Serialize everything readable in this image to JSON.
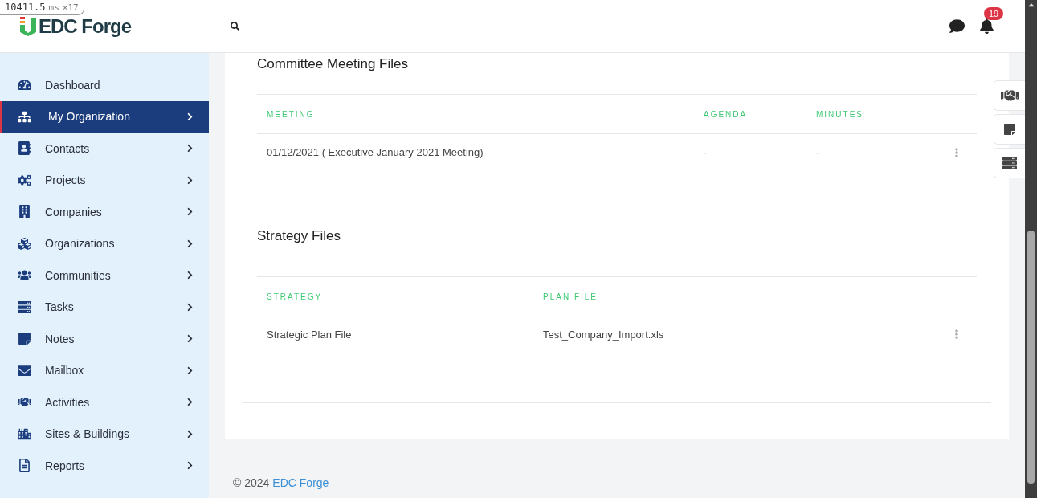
{
  "debug_overlay": {
    "time": "10411.5",
    "unit": "ms",
    "count": "×17"
  },
  "header": {
    "logo": "EDC Forge",
    "notifications": "19"
  },
  "sidebar": {
    "items": [
      {
        "label": "Dashboard",
        "selected": false,
        "expandable": false
      },
      {
        "label": "My Organization",
        "selected": true,
        "expandable": true
      },
      {
        "label": "Contacts",
        "selected": false,
        "expandable": true
      },
      {
        "label": "Projects",
        "selected": false,
        "expandable": true
      },
      {
        "label": "Companies",
        "selected": false,
        "expandable": true
      },
      {
        "label": "Organizations",
        "selected": false,
        "expandable": true
      },
      {
        "label": "Communities",
        "selected": false,
        "expandable": true
      },
      {
        "label": "Tasks",
        "selected": false,
        "expandable": true
      },
      {
        "label": "Notes",
        "selected": false,
        "expandable": true
      },
      {
        "label": "Mailbox",
        "selected": false,
        "expandable": true
      },
      {
        "label": "Activities",
        "selected": false,
        "expandable": true
      },
      {
        "label": "Sites & Buildings",
        "selected": false,
        "expandable": true
      },
      {
        "label": "Reports",
        "selected": false,
        "expandable": true
      }
    ]
  },
  "sections": [
    {
      "title": "Committee Meeting Files",
      "columns": [
        "MEETING",
        "AGENDA",
        "MINUTES"
      ],
      "rows": [
        [
          "01/12/2021 ( Executive January 2021 Meeting)",
          "-",
          "-"
        ]
      ]
    },
    {
      "title": "Strategy Files",
      "columns": [
        "STRATEGY",
        "PLAN FILE"
      ],
      "rows": [
        [
          "Strategic Plan File",
          "Test_Company_Import.xls"
        ]
      ]
    }
  ],
  "footer": {
    "text": "© 2024",
    "link": "EDC Forge"
  }
}
